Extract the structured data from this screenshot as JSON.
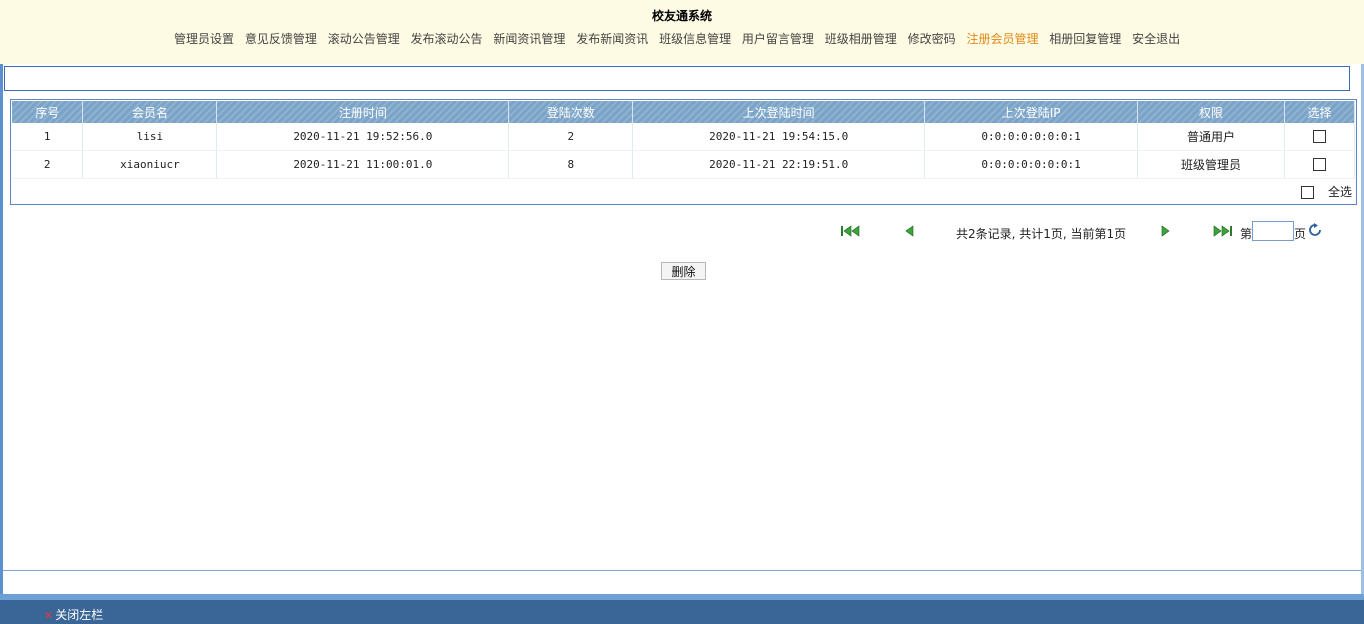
{
  "header": {
    "title": "校友通系统",
    "nav": [
      {
        "label": "管理员设置"
      },
      {
        "label": "意见反馈管理"
      },
      {
        "label": "滚动公告管理"
      },
      {
        "label": "发布滚动公告"
      },
      {
        "label": "新闻资讯管理"
      },
      {
        "label": "发布新闻资讯"
      },
      {
        "label": "班级信息管理"
      },
      {
        "label": "用户留言管理"
      },
      {
        "label": "班级相册管理"
      },
      {
        "label": "修改密码"
      },
      {
        "label": "注册会员管理",
        "active": true
      },
      {
        "label": "相册回复管理"
      },
      {
        "label": "安全退出"
      }
    ]
  },
  "search": {
    "value": ""
  },
  "table": {
    "columns": [
      "序号",
      "会员名",
      "注册时间",
      "登陆次数",
      "上次登陆时间",
      "上次登陆IP",
      "权限",
      "选择"
    ],
    "rows": [
      {
        "no": "1",
        "name": "lisi",
        "reg_time": "2020-11-21 19:52:56.0",
        "login_count": "2",
        "last_login": "2020-11-21 19:54:15.0",
        "last_ip": "0:0:0:0:0:0:0:1",
        "role": "普通用户",
        "checked": false
      },
      {
        "no": "2",
        "name": "xiaoniucr",
        "reg_time": "2020-11-21 11:00:01.0",
        "login_count": "8",
        "last_login": "2020-11-21 22:19:51.0",
        "last_ip": "0:0:0:0:0:0:0:1",
        "role": "班级管理员",
        "checked": false
      }
    ],
    "select_all_label": "全选"
  },
  "pager": {
    "summary": "共2条记录, 共计1页, 当前第1页",
    "page_prefix": "第",
    "page_suffix": "页",
    "page_value": "",
    "icons": [
      "first-page-icon",
      "prev-page-icon",
      "next-page-icon",
      "last-page-icon",
      "go-refresh-icon"
    ]
  },
  "actions": {
    "delete_label": "删除"
  },
  "footer": {
    "close_sidebar_label": "关闭左栏"
  },
  "colors": {
    "header_bg": "#fdfbe3",
    "nav_active": "#e08a1a",
    "table_header": "#7aa3c7",
    "footer_bg": "#3a6697"
  }
}
